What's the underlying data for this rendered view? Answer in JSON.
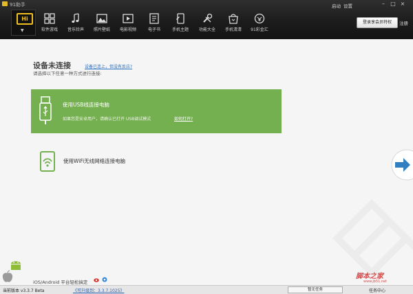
{
  "window": {
    "title": "91助手",
    "links": [
      "启动",
      "设置"
    ],
    "controls": [
      "minimize",
      "maximize",
      "close"
    ]
  },
  "toolbar": {
    "logo_text": "Hi",
    "items": [
      {
        "label": "软件游戏",
        "icon": "apps-grid-icon"
      },
      {
        "label": "音乐铃声",
        "icon": "music-note-icon"
      },
      {
        "label": "照片壁纸",
        "icon": "photo-icon"
      },
      {
        "label": "电影视频",
        "icon": "video-icon"
      },
      {
        "label": "电子书",
        "icon": "book-icon"
      },
      {
        "label": "手机主题",
        "icon": "phone-theme-icon"
      },
      {
        "label": "功能大全",
        "icon": "tools-icon"
      },
      {
        "label": "手机清清",
        "icon": "bag-icon"
      },
      {
        "label": "91彩金汇",
        "icon": "coin-icon"
      }
    ],
    "vip_login_label": "登录享会员特权",
    "register_label": "注册"
  },
  "main": {
    "heading": "设备未连接",
    "connected_link": "设备已连上，但没有反应?",
    "subheading": "请选择以下任意一种方式进行连接:",
    "usb": {
      "title": "使用USB线连接电脑",
      "description": "如果您是安卓用户，请确认已打开 USB调试模式",
      "open_link": "如何打开?"
    },
    "wifi": {
      "title": "使用WiFi无线网络连接电脑"
    },
    "platform_text": "iOS/Android 平台轻松搞定",
    "site_watermark": "脚本之家",
    "site_watermark_url": "www.jb51.net"
  },
  "statusbar": {
    "version_label": "当前版本 v3.3.7 Beta",
    "upgrade_link": "《可升级到：3.3.7.1025》",
    "task_status": "暂无任务",
    "task_center": "任务中心"
  },
  "colors": {
    "usb_panel": "#74b04f",
    "toolbar_bg": "#1c1c1c",
    "logo_yellow": "#f0c020",
    "link_blue": "#2a6fc0"
  }
}
